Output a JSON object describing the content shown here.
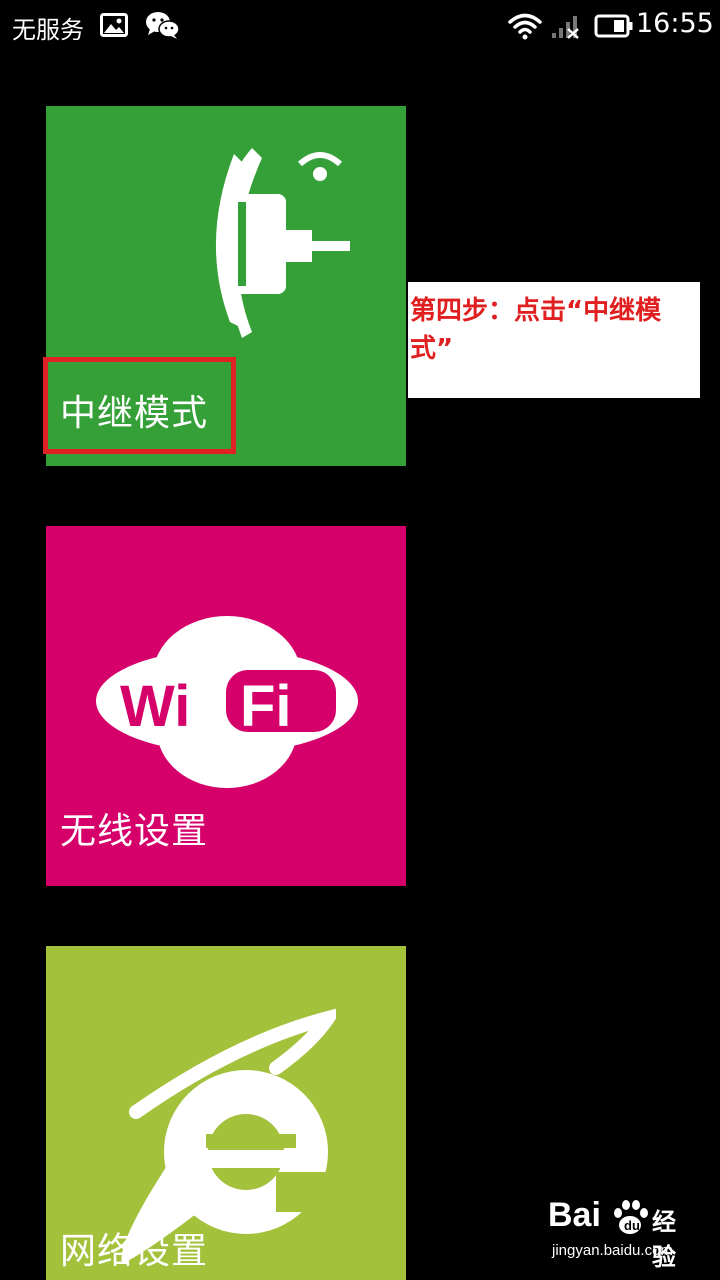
{
  "status_bar": {
    "carrier": "无服务",
    "time": "16:55",
    "icons": [
      "gallery-icon",
      "wechat-icon",
      "wifi-icon",
      "signal-icon",
      "battery-icon"
    ]
  },
  "tiles": [
    {
      "label": "中继模式",
      "icon": "repeater-icon",
      "color": "#35a038"
    },
    {
      "label": "无线设置",
      "icon": "wifi-logo-icon",
      "color": "#d6006b",
      "logo_text": [
        "Wi",
        "Fi"
      ]
    },
    {
      "label": "网络设置",
      "icon": "internet-explorer-icon",
      "color": "#a3c13a"
    }
  ],
  "annotation": {
    "text": "第四步：点击“中继模式”",
    "color": "#e02020",
    "highlight_color": "#e12224"
  },
  "watermark": {
    "logo": "Bai",
    "brand": "经验",
    "url": "jingyan.baidu.com"
  }
}
